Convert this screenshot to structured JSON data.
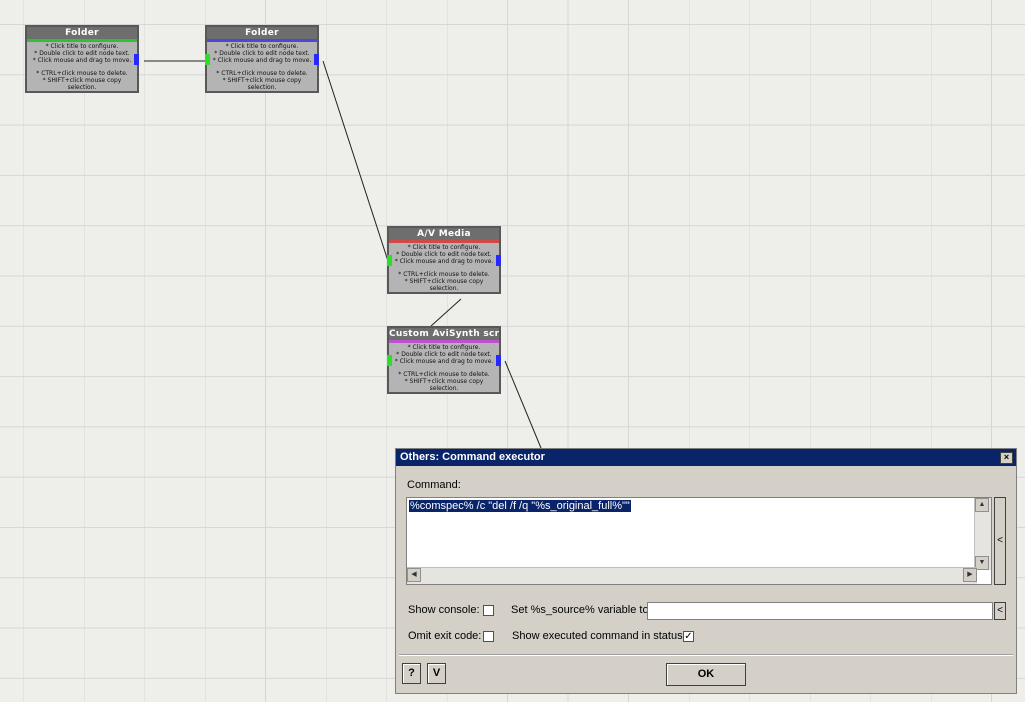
{
  "nodes": [
    {
      "title": "Folder",
      "bar_color": "#30c030",
      "has_in": false
    },
    {
      "title": "Folder",
      "bar_color": "#4848e0",
      "has_in": true
    },
    {
      "title": "A/V Media",
      "bar_color": "#d04848",
      "has_in": true
    },
    {
      "title": "Custom AviSynth script",
      "bar_color": "#c050d0",
      "has_in": true
    }
  ],
  "node_help": {
    "line1": "* Click title to configure.",
    "line2": "* Double click to edit node text.",
    "line3": "* Click mouse and drag to move.",
    "line4": "* CTRL+click mouse to delete.",
    "line5": "* SHIFT+click mouse copy",
    "line6": "selection."
  },
  "dialog": {
    "title": "Others: Command executor",
    "close_icon": "×",
    "command_label": "Command:",
    "command_value": "%comspec% /c \"del /f /q \"%s_original_full%\"\"",
    "expand_symbol": "<",
    "show_console_label": "Show console:",
    "show_console_checked": false,
    "set_source_label": "Set %s_source% variable to:",
    "set_source_value": "",
    "omit_exit_label": "Omit exit code:",
    "omit_exit_checked": false,
    "show_executed_label": "Show executed command in status:",
    "show_executed_checked": true,
    "check_mark": "✓",
    "help_label": "?",
    "v_label": "V",
    "ok_label": "OK"
  }
}
